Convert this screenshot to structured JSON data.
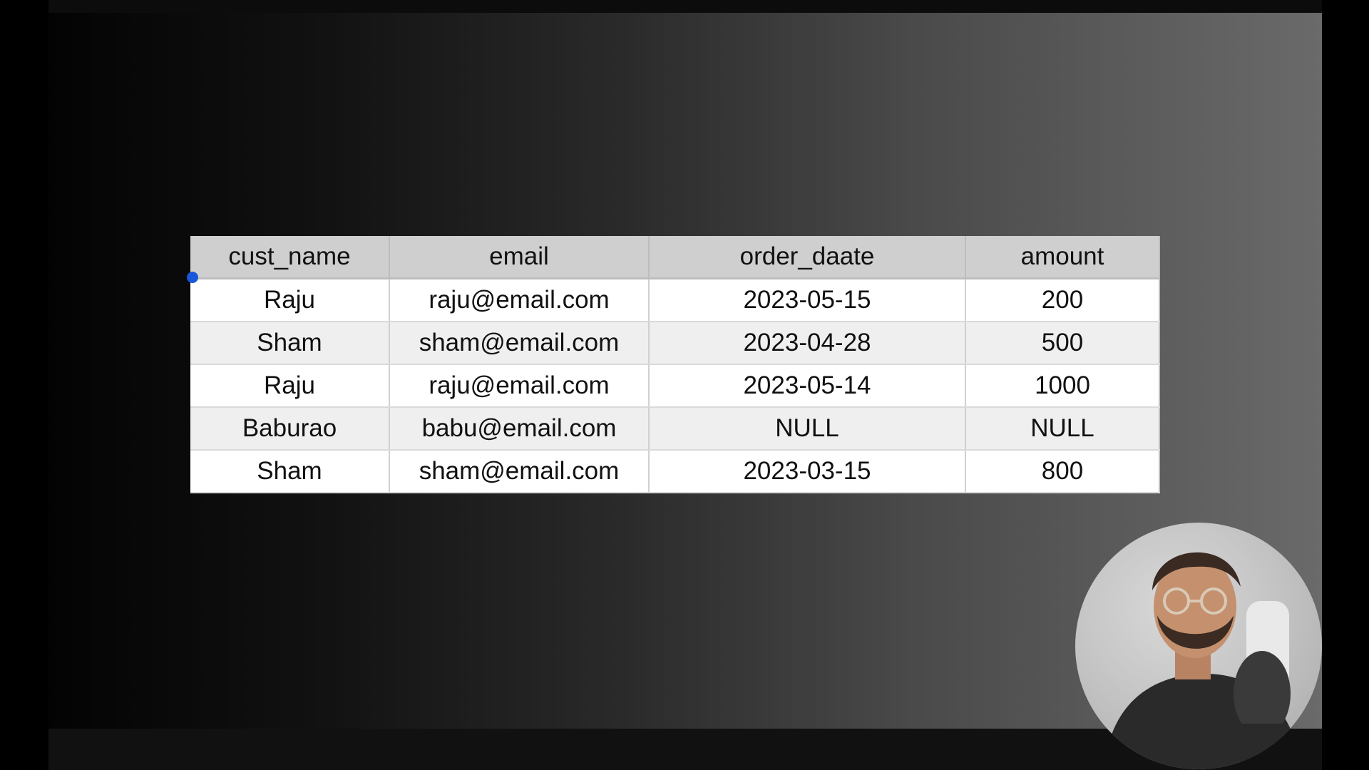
{
  "table": {
    "columns": [
      "cust_name",
      "email",
      "order_daate",
      "amount"
    ],
    "rows": [
      [
        "Raju",
        "raju@email.com",
        "2023-05-15",
        "200"
      ],
      [
        "Sham",
        "sham@email.com",
        "2023-04-28",
        "500"
      ],
      [
        "Raju",
        "raju@email.com",
        "2023-05-14",
        "1000"
      ],
      [
        "Baburao",
        "babu@email.com",
        "NULL",
        "NULL"
      ],
      [
        "Sham",
        "sham@email.com",
        "2023-03-15",
        "800"
      ]
    ]
  },
  "colors": {
    "header_bg": "#cfcfcf",
    "row_even_bg": "#efefef",
    "row_odd_bg": "#ffffff",
    "selection_handle": "#1a56d9"
  }
}
